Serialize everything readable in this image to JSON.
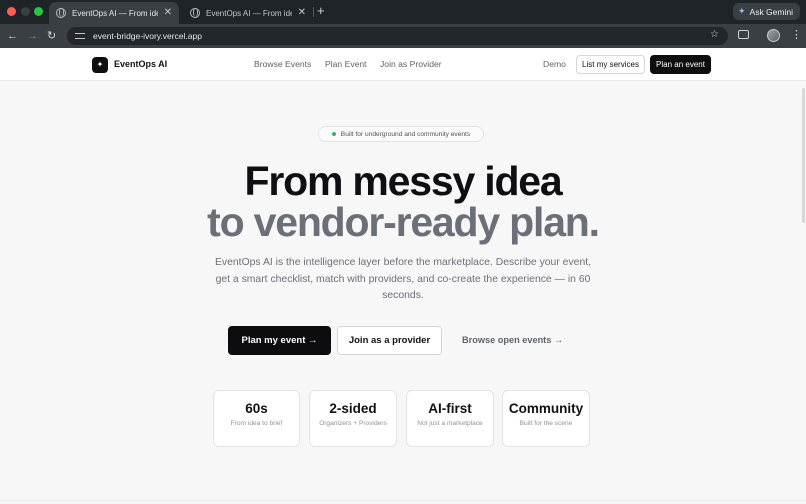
{
  "browser": {
    "tabs": [
      {
        "title": "EventOps AI — From idea to v",
        "active": true
      },
      {
        "title": "EventOps AI — From idea to v",
        "active": false
      }
    ],
    "new_tab": "+",
    "gemini_label": "Ask Gemini",
    "url": "event-bridge-ivory.vercel.app"
  },
  "header": {
    "logo_glyph": "✦",
    "brand": "EventOps AI",
    "nav": [
      "Browse Events",
      "Plan Event",
      "Join as Provider"
    ],
    "demo": "Demo",
    "list_services": "List my services",
    "plan_event": "Plan an event"
  },
  "hero": {
    "badge": "Built for underground and community events",
    "title_line1": "From messy idea",
    "title_line2": "to vendor-ready plan.",
    "subtitle": "EventOps AI is the intelligence layer before the marketplace. Describe your event, get a smart checklist, match with providers, and co-create the experience — in 60 seconds.",
    "cta_primary": "Plan my event →",
    "cta_secondary": "Join as a provider",
    "cta_link": "Browse open events →"
  },
  "stats": [
    {
      "value": "60s",
      "label": "From idea to brief"
    },
    {
      "value": "2-sided",
      "label": "Organizers + Providers"
    },
    {
      "value": "AI-first",
      "label": "Not just a marketplace"
    },
    {
      "value": "Community",
      "label": "Built for the scene"
    }
  ],
  "colors": {
    "accent": "#0d0d0f",
    "badge_dot": "#33b36b",
    "headline_muted": "#6a6f78"
  }
}
